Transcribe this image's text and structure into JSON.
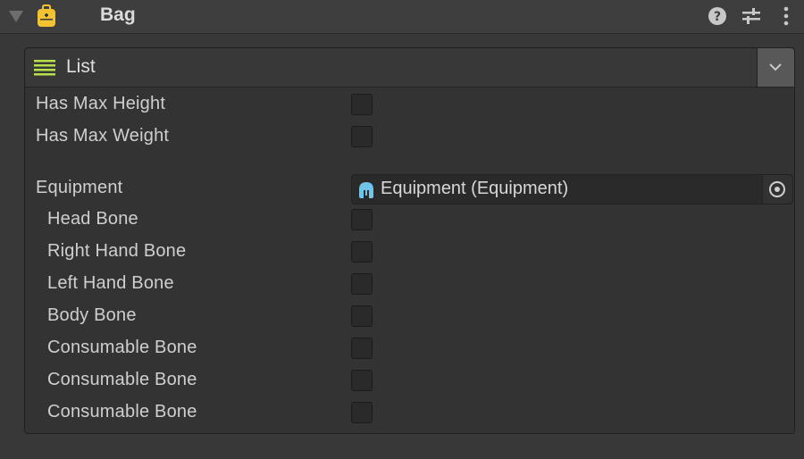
{
  "component": {
    "title": "Bag",
    "icon": "backpack-icon",
    "icon_color": "#f2c230",
    "header_buttons": [
      {
        "name": "help-icon"
      },
      {
        "name": "presets-icon"
      },
      {
        "name": "more-icon"
      }
    ]
  },
  "dropdown": {
    "selected": "List",
    "icon": "list-icon",
    "icon_color": "#b7e04a"
  },
  "fields": {
    "has_max_height": {
      "label": "Has Max Height",
      "checked": false
    },
    "has_max_weight": {
      "label": "Has Max Weight",
      "checked": false
    },
    "equipment": {
      "label": "Equipment",
      "value": "Equipment (Equipment)",
      "icon": "helmet-icon",
      "icon_color": "#6fc6ea"
    },
    "bones": [
      {
        "label": "Head Bone",
        "checked": false
      },
      {
        "label": "Right Hand Bone",
        "checked": false
      },
      {
        "label": "Left Hand Bone",
        "checked": false
      },
      {
        "label": "Body Bone",
        "checked": false
      },
      {
        "label": "Consumable Bone",
        "checked": false
      },
      {
        "label": "Consumable Bone",
        "checked": false
      },
      {
        "label": "Consumable Bone",
        "checked": false
      }
    ]
  }
}
